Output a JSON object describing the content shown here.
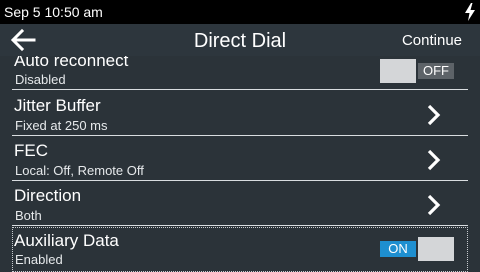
{
  "status": {
    "time": "Sep 5 10:50 am",
    "charging_icon": "lightning-bolt-icon"
  },
  "appbar": {
    "title": "Direct Dial",
    "back_icon": "arrow-left-icon",
    "action_label": "Continue"
  },
  "items": [
    {
      "title": "Auto reconnect",
      "subtitle": "Disabled",
      "control": "toggle",
      "state_label": "OFF",
      "on": false
    },
    {
      "title": "Jitter Buffer",
      "subtitle": "Fixed at 250 ms",
      "control": "chevron",
      "icon": "chevron-right-icon"
    },
    {
      "title": "FEC",
      "subtitle": "Local: Off, Remote Off",
      "control": "chevron",
      "icon": "chevron-right-icon"
    },
    {
      "title": "Direction",
      "subtitle": "Both",
      "control": "chevron",
      "icon": "chevron-right-icon"
    },
    {
      "title": "Auxiliary Data",
      "subtitle": "Enabled",
      "control": "toggle",
      "state_label": "ON",
      "on": true
    }
  ],
  "colors": {
    "background": "#2b3339",
    "statusbar": "#000000",
    "toggle_on": "#1e8fd0",
    "toggle_off": "#5d6368"
  }
}
